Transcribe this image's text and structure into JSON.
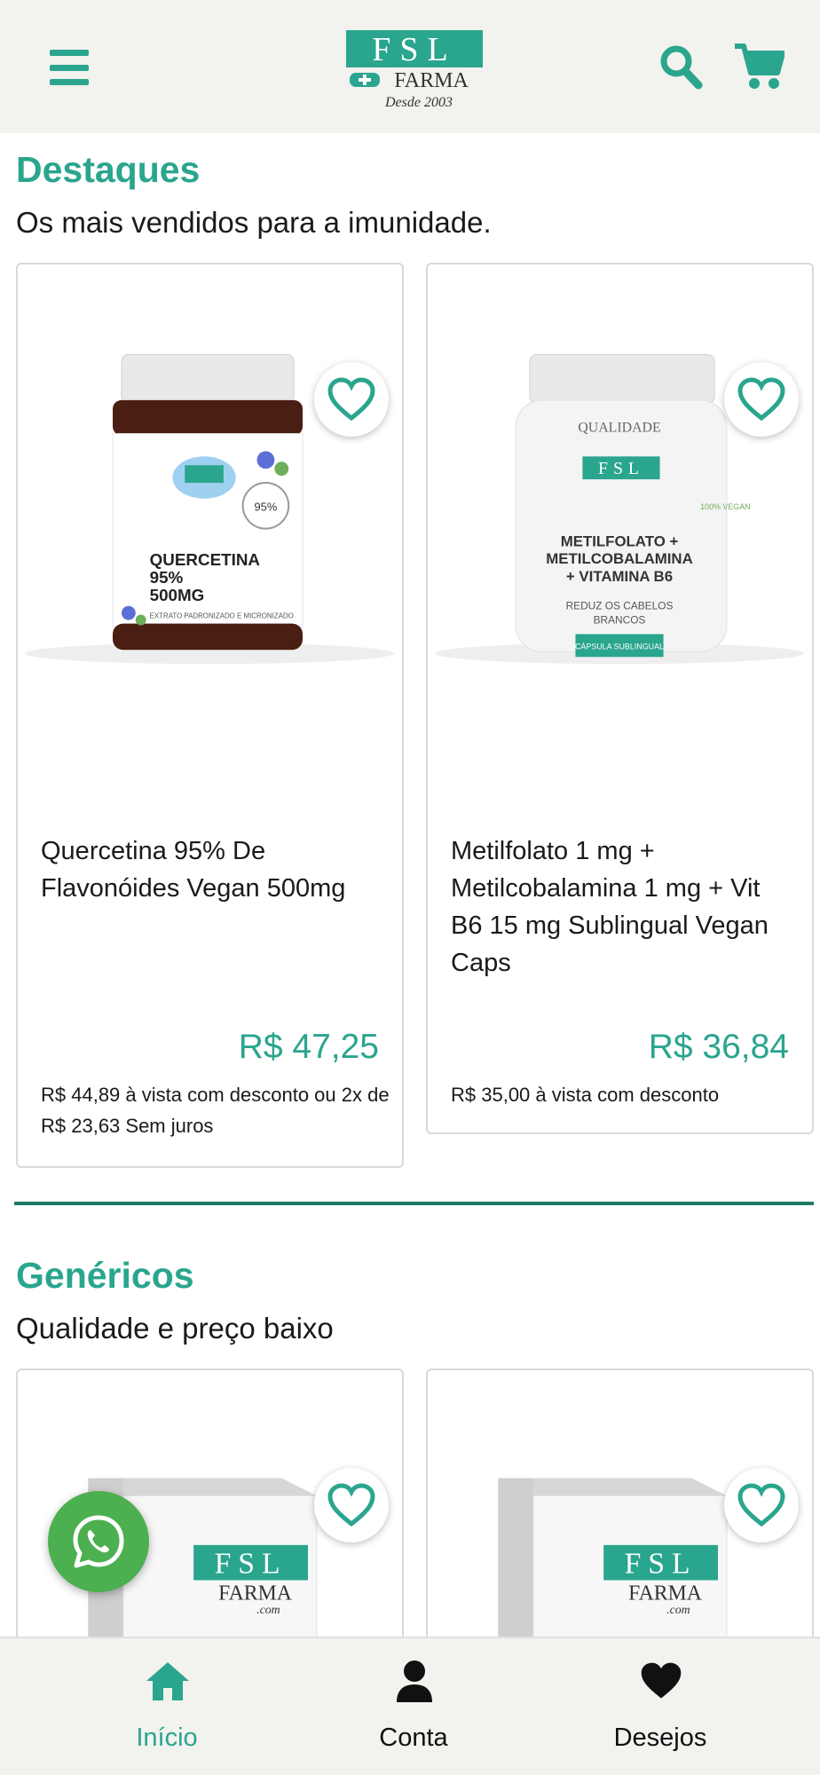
{
  "header": {
    "logo_letters": "FSL",
    "logo_sub": "FARMA",
    "logo_tag": "Desde 2003"
  },
  "sections": [
    {
      "title": "Destaques",
      "subtitle": "Os mais vendidos para a imunidade.",
      "products": [
        {
          "name": "Quercetina 95% De Flavonóides Vegan 500mg",
          "price": "R$ 47,25",
          "note": "R$ 44,89 à vista com desconto ou 2x de R$ 23,63 Sem juros",
          "label_lines": [
            "QUERCETINA",
            "95%",
            "500MG"
          ],
          "label_small": "EXTRATO PADRONIZADO E MICRONIZADO",
          "label_badge": "95%"
        },
        {
          "name": "Metilfolato 1 mg + Metilcobalamina 1 mg + Vit B6 15 mg Sublingual Vegan Caps",
          "price": "R$ 36,84",
          "note": "R$ 35,00 à vista com desconto",
          "label_top": "QUALIDADE",
          "label_lines": [
            "METILFOLATO +",
            "METILCOBALAMINA",
            "+ VITAMINA B6"
          ],
          "label_small_1": "REDUZ OS CABELOS",
          "label_small_2": "BRANCOS",
          "label_badge": "CÁPSULA SUBLINGUAL",
          "label_vegan": "100% VEGAN"
        }
      ]
    },
    {
      "title": "Genéricos",
      "subtitle": "Qualidade e preço baixo",
      "products": [
        {
          "box_brand": "FSL",
          "box_sub": "FARMA",
          "box_com": ".com"
        },
        {
          "box_brand": "FSL",
          "box_sub": "FARMA",
          "box_com": ".com"
        }
      ]
    }
  ],
  "bottom_nav": [
    {
      "label": "Início",
      "icon": "home-icon",
      "active": true
    },
    {
      "label": "Conta",
      "icon": "user-icon",
      "active": false
    },
    {
      "label": "Desejos",
      "icon": "heart-icon",
      "active": false
    }
  ],
  "colors": {
    "accent": "#2aa58e",
    "divider": "#1f7a64",
    "whatsapp": "#4caf50",
    "header_bg": "#f2f2ef"
  }
}
